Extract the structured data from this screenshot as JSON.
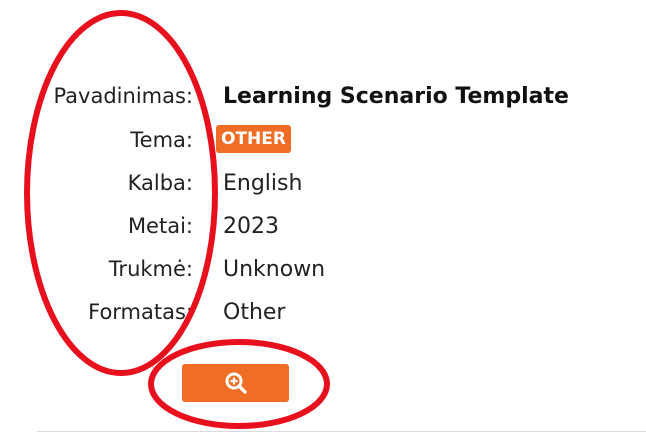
{
  "details": {
    "rows": [
      {
        "label": "Pavadinimas:",
        "value": "Learning Scenario Template"
      },
      {
        "label": "Tema:",
        "value": "OTHER"
      },
      {
        "label": "Kalba:",
        "value": "English"
      },
      {
        "label": "Metai:",
        "value": "2023"
      },
      {
        "label": "Trukmė:",
        "value": "Unknown"
      },
      {
        "label": "Formatas:",
        "value": "Other"
      }
    ]
  },
  "buttons": {
    "zoom_icon": "zoom-in-icon"
  },
  "colors": {
    "accent": "#ef6d25",
    "annotation": "#e8101c",
    "divider": "#dcdcdc"
  }
}
